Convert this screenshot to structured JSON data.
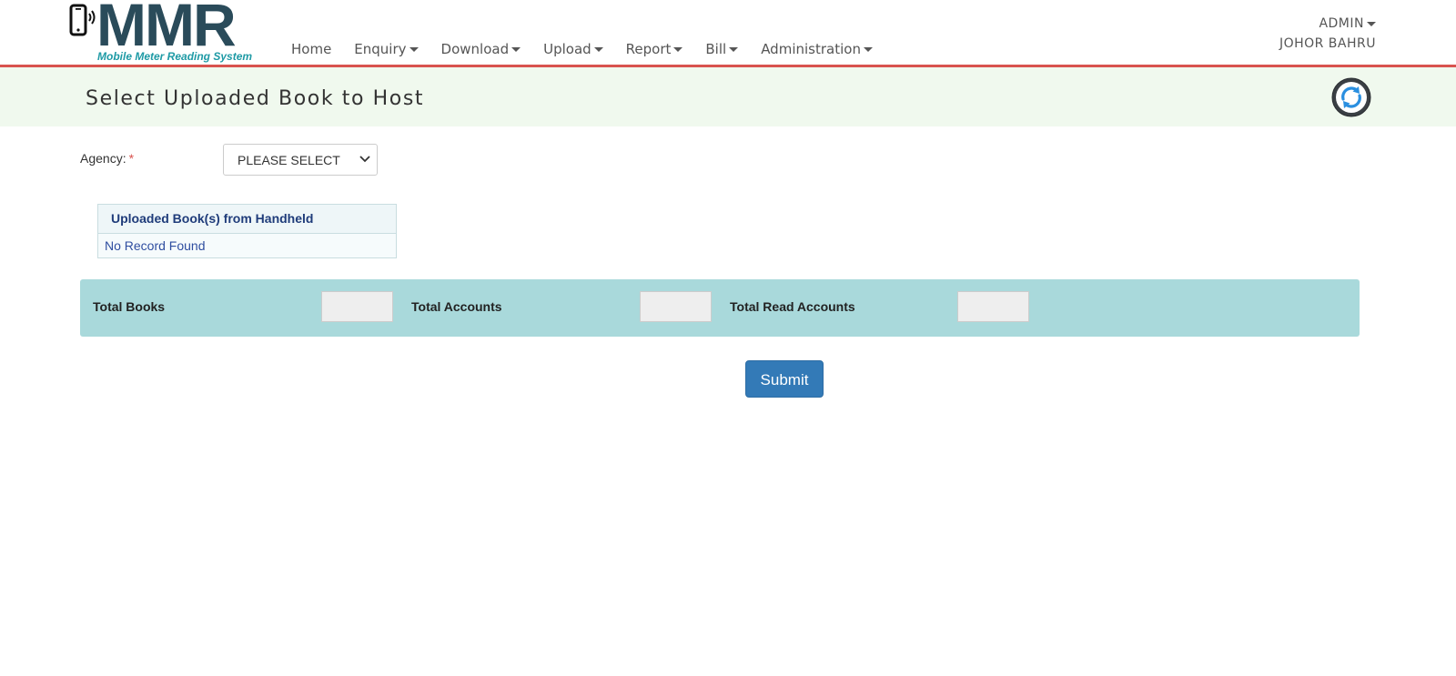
{
  "logo": {
    "text": "MMR",
    "subtitle": "Mobile Meter Reading System"
  },
  "nav": {
    "home": "Home",
    "enquiry": "Enquiry",
    "download": "Download",
    "upload": "Upload",
    "report": "Report",
    "bill": "Bill",
    "administration": "Administration"
  },
  "user": {
    "name": "ADMIN",
    "location": "JOHOR BAHRU"
  },
  "page": {
    "title": "Select Uploaded Book to Host"
  },
  "form": {
    "agency_label": "Agency:",
    "required_mark": "*",
    "agency_selected": "PLEASE SELECT"
  },
  "book_table": {
    "header": "Uploaded Book(s) from Handheld",
    "empty_text": "No Record Found"
  },
  "totals": {
    "books_label": "Total Books",
    "accounts_label": "Total Accounts",
    "read_accounts_label": "Total Read Accounts"
  },
  "actions": {
    "submit_label": "Submit"
  },
  "colors": {
    "brand_dark": "#2a4b5a",
    "brand_teal": "#1e9aa5",
    "header_rule": "#d9534f",
    "title_bar_bg": "#f0f9ee",
    "totals_bg": "#a9d9db",
    "primary_button": "#337ab7"
  },
  "icons": {
    "phone": "mobile-phone-signal-icon",
    "refresh": "refresh-icon",
    "caret": "caret-down-icon",
    "select_chevron": "chevron-down-icon"
  }
}
